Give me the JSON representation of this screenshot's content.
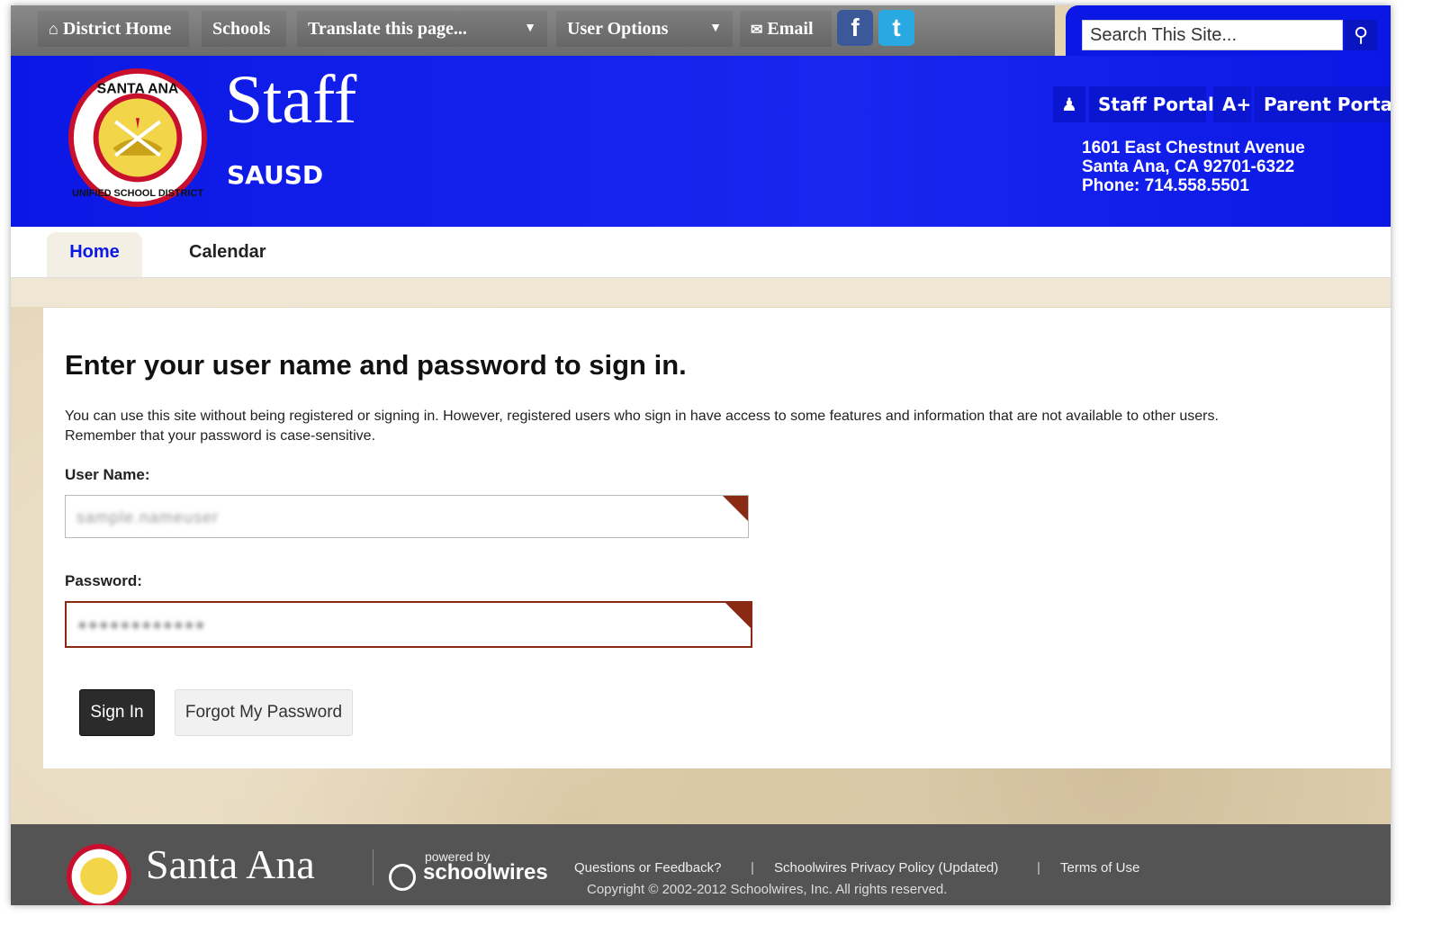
{
  "topbar": {
    "district_home": "District Home",
    "schools": "Schools",
    "translate": "Translate this page...",
    "user_options": "User Options",
    "email": "Email",
    "facebook_glyph": "f",
    "twitter_glyph": "t"
  },
  "search": {
    "placeholder": "Search This Site...",
    "value": "Search This Site..."
  },
  "header": {
    "title": "Staff",
    "subtitle": "SAUSD",
    "logo_top_text": "SANTA ANA",
    "logo_bottom_text": "UNIFIED SCHOOL DISTRICT",
    "staff_portal": "Staff Portal",
    "aplus": "A+",
    "parent_portal": "Parent Portal",
    "address_line1": "1601 East Chestnut Avenue",
    "address_line2": "Santa Ana, CA 92701-6322",
    "phone": "Phone: 714.558.5501"
  },
  "nav": {
    "tabs": [
      {
        "label": "Home"
      },
      {
        "label": "Calendar"
      }
    ]
  },
  "signin": {
    "heading": "Enter your user name and password to sign in.",
    "intro_line1": "You can use this site without being registered or signing in. However, registered users who sign in have access to some features and information that are not available to other users.",
    "intro_line2": "Remember that your password is case-sensitive.",
    "username_label": "User Name:",
    "username_value": "sample.nameuser",
    "password_label": "Password:",
    "password_value": "●●●●●●●●●●●●",
    "signin_button": "Sign In",
    "forgot_button": "Forgot My Password"
  },
  "footer": {
    "district_name": "Santa Ana",
    "powered_by": "powered by",
    "brand": "schoolwires",
    "links": [
      "Questions or Feedback?",
      "Schoolwires Privacy Policy (Updated)",
      "Terms of Use"
    ],
    "separator": "|",
    "copyright": "Copyright © 2002-2012 Schoolwires, Inc. All rights reserved."
  },
  "colors": {
    "brand_blue": "#0b18e5",
    "accent_red": "#8b2a14",
    "footer_gray": "#545454",
    "topbar_gray": "#6c6c6c"
  },
  "icons": [
    "home-icon",
    "chevron-down-icon",
    "email-icon",
    "facebook-icon",
    "twitter-icon",
    "search-icon",
    "person-icon"
  ]
}
